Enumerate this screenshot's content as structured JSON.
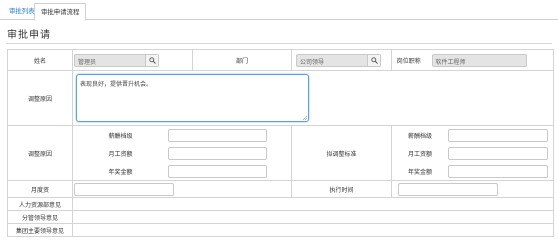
{
  "tabs": [
    {
      "label": "审批列表",
      "active": false
    },
    {
      "label": "审批申请流程",
      "active": true
    }
  ],
  "page_title": "审批申请",
  "form": {
    "name_label": "姓名",
    "name_value": "管理员",
    "dept_label": "部门",
    "dept_value": "公司领导",
    "position_label": "岗位职称",
    "position_value": "软件工程师",
    "reason_label": "调整原因",
    "reason_value": "表现良好，提供晋升机会。",
    "adjust_reason_label": "调整原因",
    "proposed_label": "拟调整标准",
    "sub_labels": [
      "薪酬档级",
      "月工资额",
      "年奖金额"
    ],
    "monthly_label": "月度资",
    "exec_time_label": "执行时间",
    "hr_label": "人力资源部意见",
    "branch_label": "分管领导意见",
    "group_label": "集团主要领导意见"
  },
  "colors": {
    "accent": "#2a7bd0",
    "border": "#d4d4d4",
    "focus": "#5aa0e0"
  }
}
